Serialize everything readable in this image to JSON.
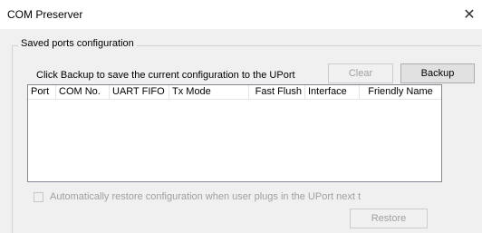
{
  "window": {
    "title": "COM Preserver",
    "close_glyph": "✕"
  },
  "group": {
    "legend": "Saved ports configuration"
  },
  "hint_text": "Click Backup to save the current configuration to the UPort",
  "buttons": {
    "clear": "Clear",
    "backup": "Backup",
    "restore": "Restore"
  },
  "table": {
    "columns": [
      "Port",
      "COM No.",
      "UART FIFO",
      "Tx Mode",
      "Fast Flush",
      "Interface",
      "Friendly Name"
    ],
    "rows": []
  },
  "auto_restore": {
    "label": "Automatically restore configuration when user plugs in the UPort next t",
    "checked": false
  },
  "icons": {
    "close": "close-icon"
  }
}
